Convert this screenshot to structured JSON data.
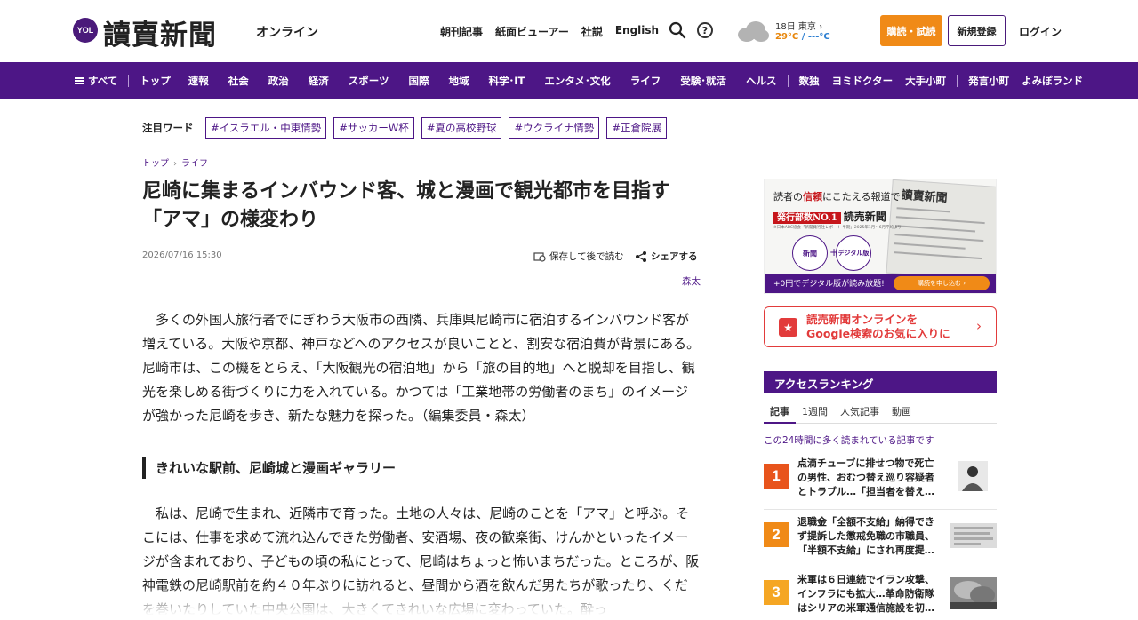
{
  "header": {
    "logo_mark": "YOL",
    "logo_text": "讀賣新聞",
    "logo_suffix": "オンライン",
    "nav": [
      "朝刊記事",
      "紙面ビューアー",
      "社説",
      "English"
    ],
    "weather": {
      "date_place": "18日 東京",
      "high": "29°C",
      "sep": " / ",
      "low": "---°C"
    },
    "subscribe_label": "購読・試読",
    "register_label": "新規登録",
    "login_label": "ログイン"
  },
  "category_nav": {
    "all_label": "すべて",
    "group1": [
      "トップ",
      "速報",
      "社会",
      "政治",
      "経済",
      "スポーツ",
      "国際",
      "地域",
      "科学･IT",
      "エンタメ･文化",
      "ライフ",
      "受験･就活",
      "ヘルス"
    ],
    "group2": [
      "数独",
      "ヨミドクター",
      "大手小町"
    ],
    "group3": [
      "発言小町",
      "よみぽランド"
    ]
  },
  "attention": {
    "label": "注目ワード",
    "tags": [
      "#イスラエル・中東情勢",
      "#サッカーW杯",
      "#夏の高校野球",
      "#ウクライナ情勢",
      "#正倉院展"
    ]
  },
  "breadcrumb": [
    "トップ",
    "ライフ"
  ],
  "article": {
    "title": "尼崎に集まるインバウンド客、城と漫画で観光都市を目指す「アマ」の様変わり",
    "date": "2026/07/16 15:30",
    "save_label": "保存して後で読む",
    "share_label": "シェアする",
    "author": "森太",
    "lead": "多くの外国人旅行者でにぎわう大阪市の西隣、兵庫県尼崎市に宿泊するインバウンド客が増えている。大阪や京都、神戸などへのアクセスが良いことと、割安な宿泊費が背景にある。尼崎市は、この機をとらえ、「大阪観光の宿泊地」から「旅の目的地」へと脱却を目指し、観光を楽しめる街づくりに力を入れている。かつては「工業地帯の労働者のまち」のイメージが強かった尼崎を歩き、新たな魅力を探った。（編集委員・森太）",
    "subheading": "きれいな駅前、尼崎城と漫画ギャラリー",
    "body": "私は、尼崎で生まれ、近隣市で育った。土地の人々は、尼崎のことを「アマ」と呼ぶ。そこには、仕事を求めて流れ込んできた労働者、安酒場、夜の歓楽街、けんかといったイメージが含まれており、子どもの頃の私にとって、尼崎はちょっと怖いまちだった。ところが、阪神電鉄の尼崎駅前を約４０年ぶりに訪れると、昼間から酒を飲んだ男たちが歌ったり、くだを巻いたりしていた中央公園は、大きくてきれいな広場に変わっていた。酔っ"
  },
  "ad1": {
    "headline_a": "読者の",
    "headline_b": "信頼",
    "headline_c": "にこたえる報道で",
    "badge": "発行部数NO.1",
    "badge_after": "読売新聞",
    "fine_print": "※日本ABC協会「新聞発行社レポート 半期」2025年1月～6月平均より",
    "circle1": "新聞",
    "circle2": "デジタル版",
    "paper_title": "讀賣新聞",
    "bar_text": "+0円でデジタル版が読み放題!",
    "bar_button": "購読を申し込む"
  },
  "ad2": {
    "line1": "読売新聞オンラインを",
    "line2": "Google検索のお気に入りに"
  },
  "ranking": {
    "title": "アクセスランキング",
    "tabs": [
      "記事",
      "1週間",
      "人気記事",
      "動画"
    ],
    "note": "この24時間に多く読まれている記事です",
    "items": [
      {
        "rank": "1",
        "text": "点滴チューブに排せつ物で死亡の男性、おむつ替え巡り容疑者とトラブル…「担当者を替え…",
        "color": "#e8541c"
      },
      {
        "rank": "2",
        "text": "退職金「全額不支給」納得できず提訴した懲戒免職の市職員、「半額不支給」にされ再度提…",
        "color": "#f08a17"
      },
      {
        "rank": "3",
        "text": "米軍は６日連続でイラン攻撃、インフラにも拡大…革命防衛隊はシリアの米軍通信施設を初…",
        "color": "#f5a623"
      }
    ]
  }
}
